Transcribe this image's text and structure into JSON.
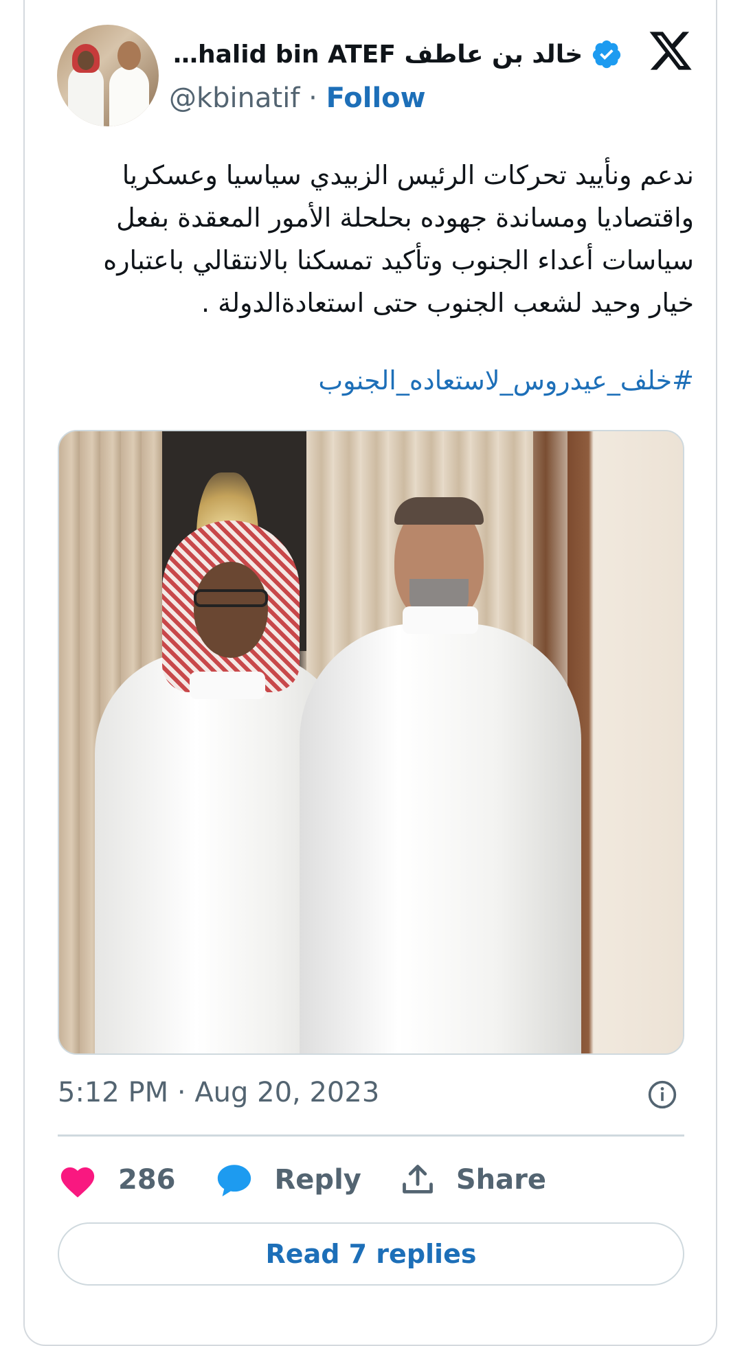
{
  "header": {
    "display_name": "خالد بن عاطف Khalid bin ATEF",
    "display_name_shown": "…halid bin ATEF خالد بن عاطف",
    "handle": "@kbinatif",
    "separator": "·",
    "follow_label": "Follow",
    "verified_icon": "verified-badge-icon",
    "platform_icon": "x-logo-icon"
  },
  "tweet": {
    "text_lines": [
      "ندعم ونأييد تحركات الرئيس الزبيدي سياسيا وعسكريا",
      "واقتصاديا ومساندة جهوده بحلحلة الأمور المعقدة بفعل",
      "سياسات أعداء الجنوب وتأكيد تمسكنا بالانتقالي باعتباره",
      "خيار وحيد لشعب الجنوب حتى استعادةالدولة ."
    ],
    "hashtag": "#خلف_عيدروس_لاستعاده_الجنوب"
  },
  "meta": {
    "timestamp": "5:12 PM · Aug 20, 2023",
    "info_icon": "info-icon"
  },
  "actions": {
    "like_count": "286",
    "reply_label": "Reply",
    "share_label": "Share"
  },
  "footer": {
    "read_replies_label": "Read 7 replies"
  },
  "colors": {
    "accent": "#1d6fb8",
    "like": "#f91880",
    "reply_icon": "#1d9bf0",
    "muted": "#536471",
    "border": "#cfd9de"
  }
}
